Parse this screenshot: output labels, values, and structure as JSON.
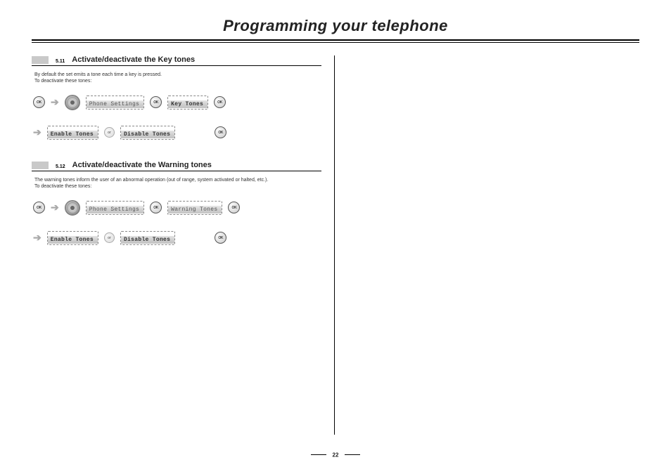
{
  "title": "Programming your telephone",
  "page_number": "22",
  "ok_label": "OK",
  "or_label": "or",
  "sections": [
    {
      "num": "5.11",
      "title": "Activate/deactivate the Key tones",
      "body_line1": "By default the set emits a tone each time a key is pressed.",
      "body_line2": "To deactivate these tones:",
      "row1": {
        "pill1": "Phone Settings",
        "pill2": "Key Tones"
      },
      "row2": {
        "pill1": "Enable Tones",
        "pill2": "Disable Tones"
      }
    },
    {
      "num": "5.12",
      "title": "Activate/deactivate the Warning tones",
      "body_line1": "The warning tones inform the user of an abnormal operation (out of range, system activated or halted, etc.).",
      "body_line2": "To deactivate these tones:",
      "row1": {
        "pill1": "Phone Settings",
        "pill2": "Warning Tones"
      },
      "row2": {
        "pill1": "Enable Tones",
        "pill2": "Disable Tones"
      }
    }
  ]
}
